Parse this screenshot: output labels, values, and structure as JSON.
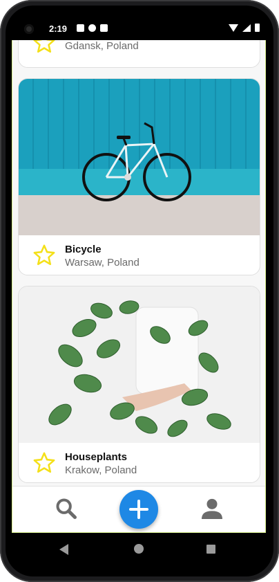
{
  "status_bar": {
    "time": "2:19"
  },
  "cards": [
    {
      "title": "",
      "location": "Gdansk, Poland",
      "favorite": false
    },
    {
      "title": "Bicycle",
      "location": "Warsaw, Poland",
      "favorite": false
    },
    {
      "title": "Houseplants",
      "location": "Krakow, Poland",
      "favorite": false
    }
  ],
  "bottom_nav": {
    "left_icon": "search-icon",
    "center_icon": "add-icon",
    "right_icon": "person-icon"
  },
  "colors": {
    "accent": "#1e88e5",
    "star": "#f4e01a",
    "nav_icon": "#6b6b6b"
  }
}
